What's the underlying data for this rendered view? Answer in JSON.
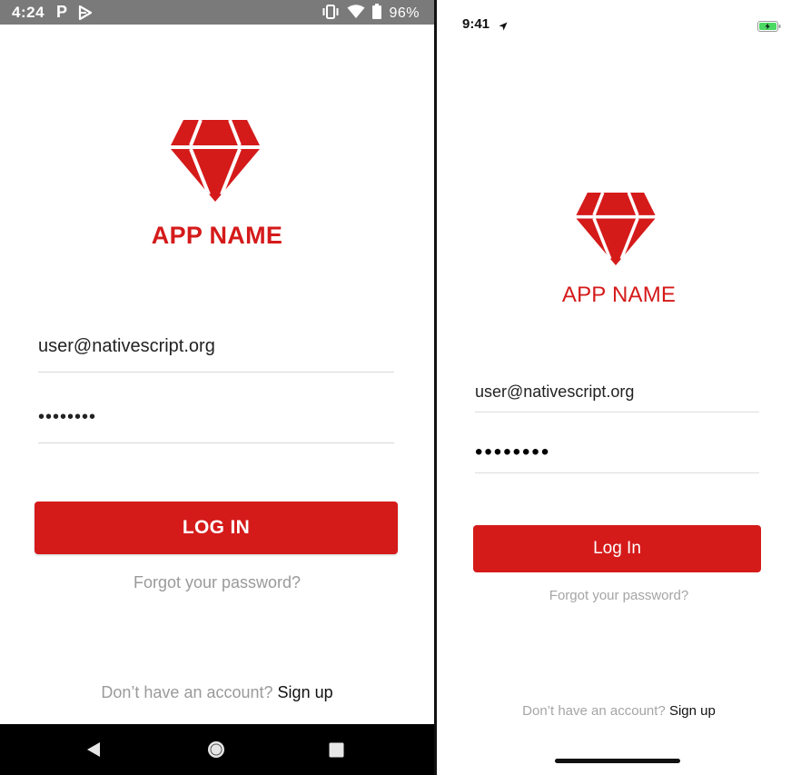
{
  "android": {
    "status_bar": {
      "time": "4:24",
      "notification_letter": "P",
      "battery_percent": "96%"
    },
    "app_name": "APP NAME",
    "email_value": "user@nativescript.org",
    "password_value": "••••••••",
    "login_label": "LOG IN",
    "forgot_label": "Forgot your password?",
    "signup_prompt": "Don’t have an account?",
    "signup_link": "Sign up"
  },
  "ios": {
    "status_bar": {
      "time": "9:41"
    },
    "app_name": "APP NAME",
    "email_value": "user@nativescript.org",
    "password_value": "••••••••",
    "login_label": "Log In",
    "forgot_label": "Forgot your password?",
    "signup_prompt": "Don’t have an account?",
    "signup_link": "Sign up"
  },
  "colors": {
    "brand_red": "#d51a1a",
    "muted_text": "#9a9a9a",
    "android_status_bar": "#7a7a7a",
    "android_nav_bar": "#000000"
  },
  "icons": {
    "logo": "diamond-icon",
    "android_status": [
      "vibrate-icon",
      "wifi-icon",
      "battery-icon"
    ],
    "android_nav": [
      "nav-back-icon",
      "nav-home-icon",
      "nav-recent-icon"
    ],
    "ios_status": [
      "location-arrow-icon",
      "battery-charging-icon"
    ]
  }
}
